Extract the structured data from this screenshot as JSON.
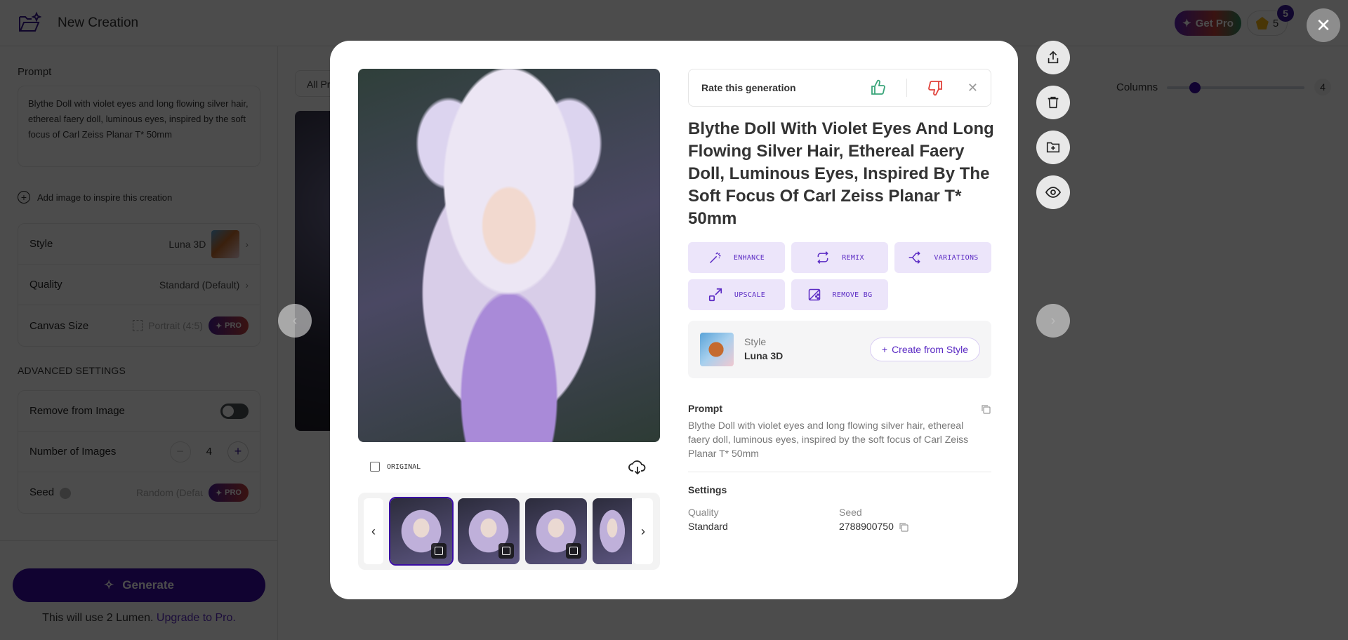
{
  "header": {
    "title": "New Creation",
    "get_pro": "Get Pro",
    "credits": "5",
    "notification_count": "5"
  },
  "sidebar": {
    "prompt_label": "Prompt",
    "prompt_value": "Blythe Doll with violet eyes and long flowing silver hair, ethereal faery doll, luminous eyes, inspired by the soft focus of Carl Zeiss Planar T* 50mm",
    "add_image": "Add image to inspire this creation",
    "settings": [
      {
        "label": "Style",
        "value": "Luna 3D"
      },
      {
        "label": "Quality",
        "value": "Standard (Default)"
      },
      {
        "label": "Canvas Size",
        "value": "Portrait (4:5)",
        "badge": "PRO"
      }
    ],
    "advanced_label": "ADVANCED SETTINGS",
    "advanced": {
      "remove_label": "Remove from Image",
      "remove_on": false,
      "num_images_label": "Number of Images",
      "num_images": "4",
      "seed_label": "Seed",
      "seed_placeholder": "Random (Default)",
      "seed_badge": "PRO"
    },
    "generate": "Generate",
    "lumen_note": "This will use 2 Lumen.",
    "upgrade_link": "Upgrade to Pro."
  },
  "gallery": {
    "filter": "All Prompts",
    "columns_label": "Columns",
    "columns_value": "4",
    "columns_fraction": 0.25
  },
  "modal": {
    "rate_label": "Rate this generation",
    "title": "Blythe Doll With Violet Eyes And Long Flowing Silver Hair, Ethereal Faery Doll, Luminous Eyes, Inspired By The Soft Focus Of Carl Zeiss Planar T* 50mm",
    "original_label": "ORIGINAL",
    "actions": [
      "ENHANCE",
      "REMIX",
      "VARIATIONS",
      "UPSCALE",
      "REMOVE BG"
    ],
    "style_caption": "Style",
    "style_name": "Luna 3D",
    "create_from_style": "Create from Style",
    "prompt_heading": "Prompt",
    "prompt_text": "Blythe Doll with violet eyes and long flowing silver hair, ethereal faery doll, luminous eyes, inspired by the soft focus of Carl Zeiss Planar T* 50mm",
    "settings_heading": "Settings",
    "quality_label": "Quality",
    "quality_value": "Standard",
    "seed_label": "Seed",
    "seed_value": "2788900750",
    "thumbnails": 4,
    "selected_thumbnail": 1
  },
  "colors": {
    "brand": "#3a0ca3",
    "accent_light": "#ece5fa",
    "thumbs_up": "#3aa57a",
    "thumbs_down": "#e0413a"
  }
}
